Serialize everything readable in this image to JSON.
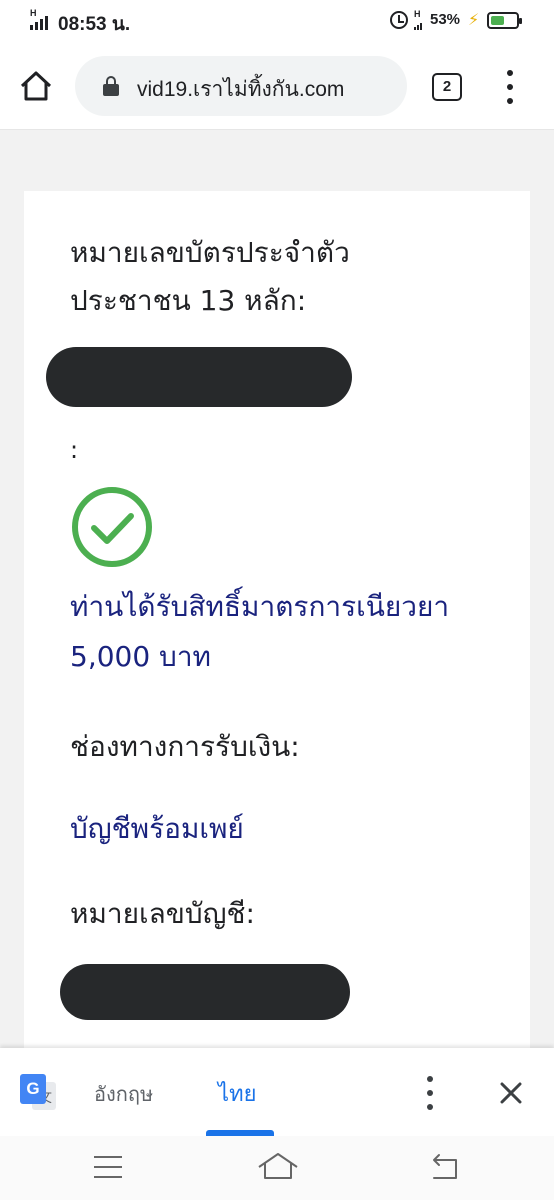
{
  "status_bar": {
    "network_letter": "H",
    "time": "08:53 น.",
    "network_letter_2": "H",
    "battery_percent": "53%",
    "battery_level": 0.53,
    "icons": [
      "signal-icon",
      "alarm-icon",
      "signal-icon",
      "charging-icon",
      "battery-icon"
    ]
  },
  "browser": {
    "url": "vid19.เราไม่ทิ้งกัน.com",
    "tab_count": "2",
    "icons": [
      "home-icon",
      "lock-icon",
      "tabs-icon",
      "more-vert-icon"
    ]
  },
  "page": {
    "id_label_line1": "หมายเลขบัตรประจำตัว",
    "id_label_line2": "ประชาชน 13 หลัก:",
    "colon": ":",
    "result_line1": "ท่านได้รับสิทธิ์มาตรการเนียวยา",
    "result_line2": "5,000 บาท",
    "channel_label": "ช่องทางการรับเงิน:",
    "channel_value": "บัญชีพร้อมเพย์",
    "account_label": "หมายเลขบัญชี:",
    "colors": {
      "result_text": "#1a237e",
      "check": "#4caf50",
      "redaction": "#27292b"
    }
  },
  "translate_bar": {
    "source_language": "อังกฤษ",
    "target_language": "ไทย",
    "selected": "ไทย",
    "accent_color": "#1a73e8"
  },
  "nav_bar": {
    "icons": [
      "recent-apps-icon",
      "home-icon",
      "back-icon"
    ]
  }
}
